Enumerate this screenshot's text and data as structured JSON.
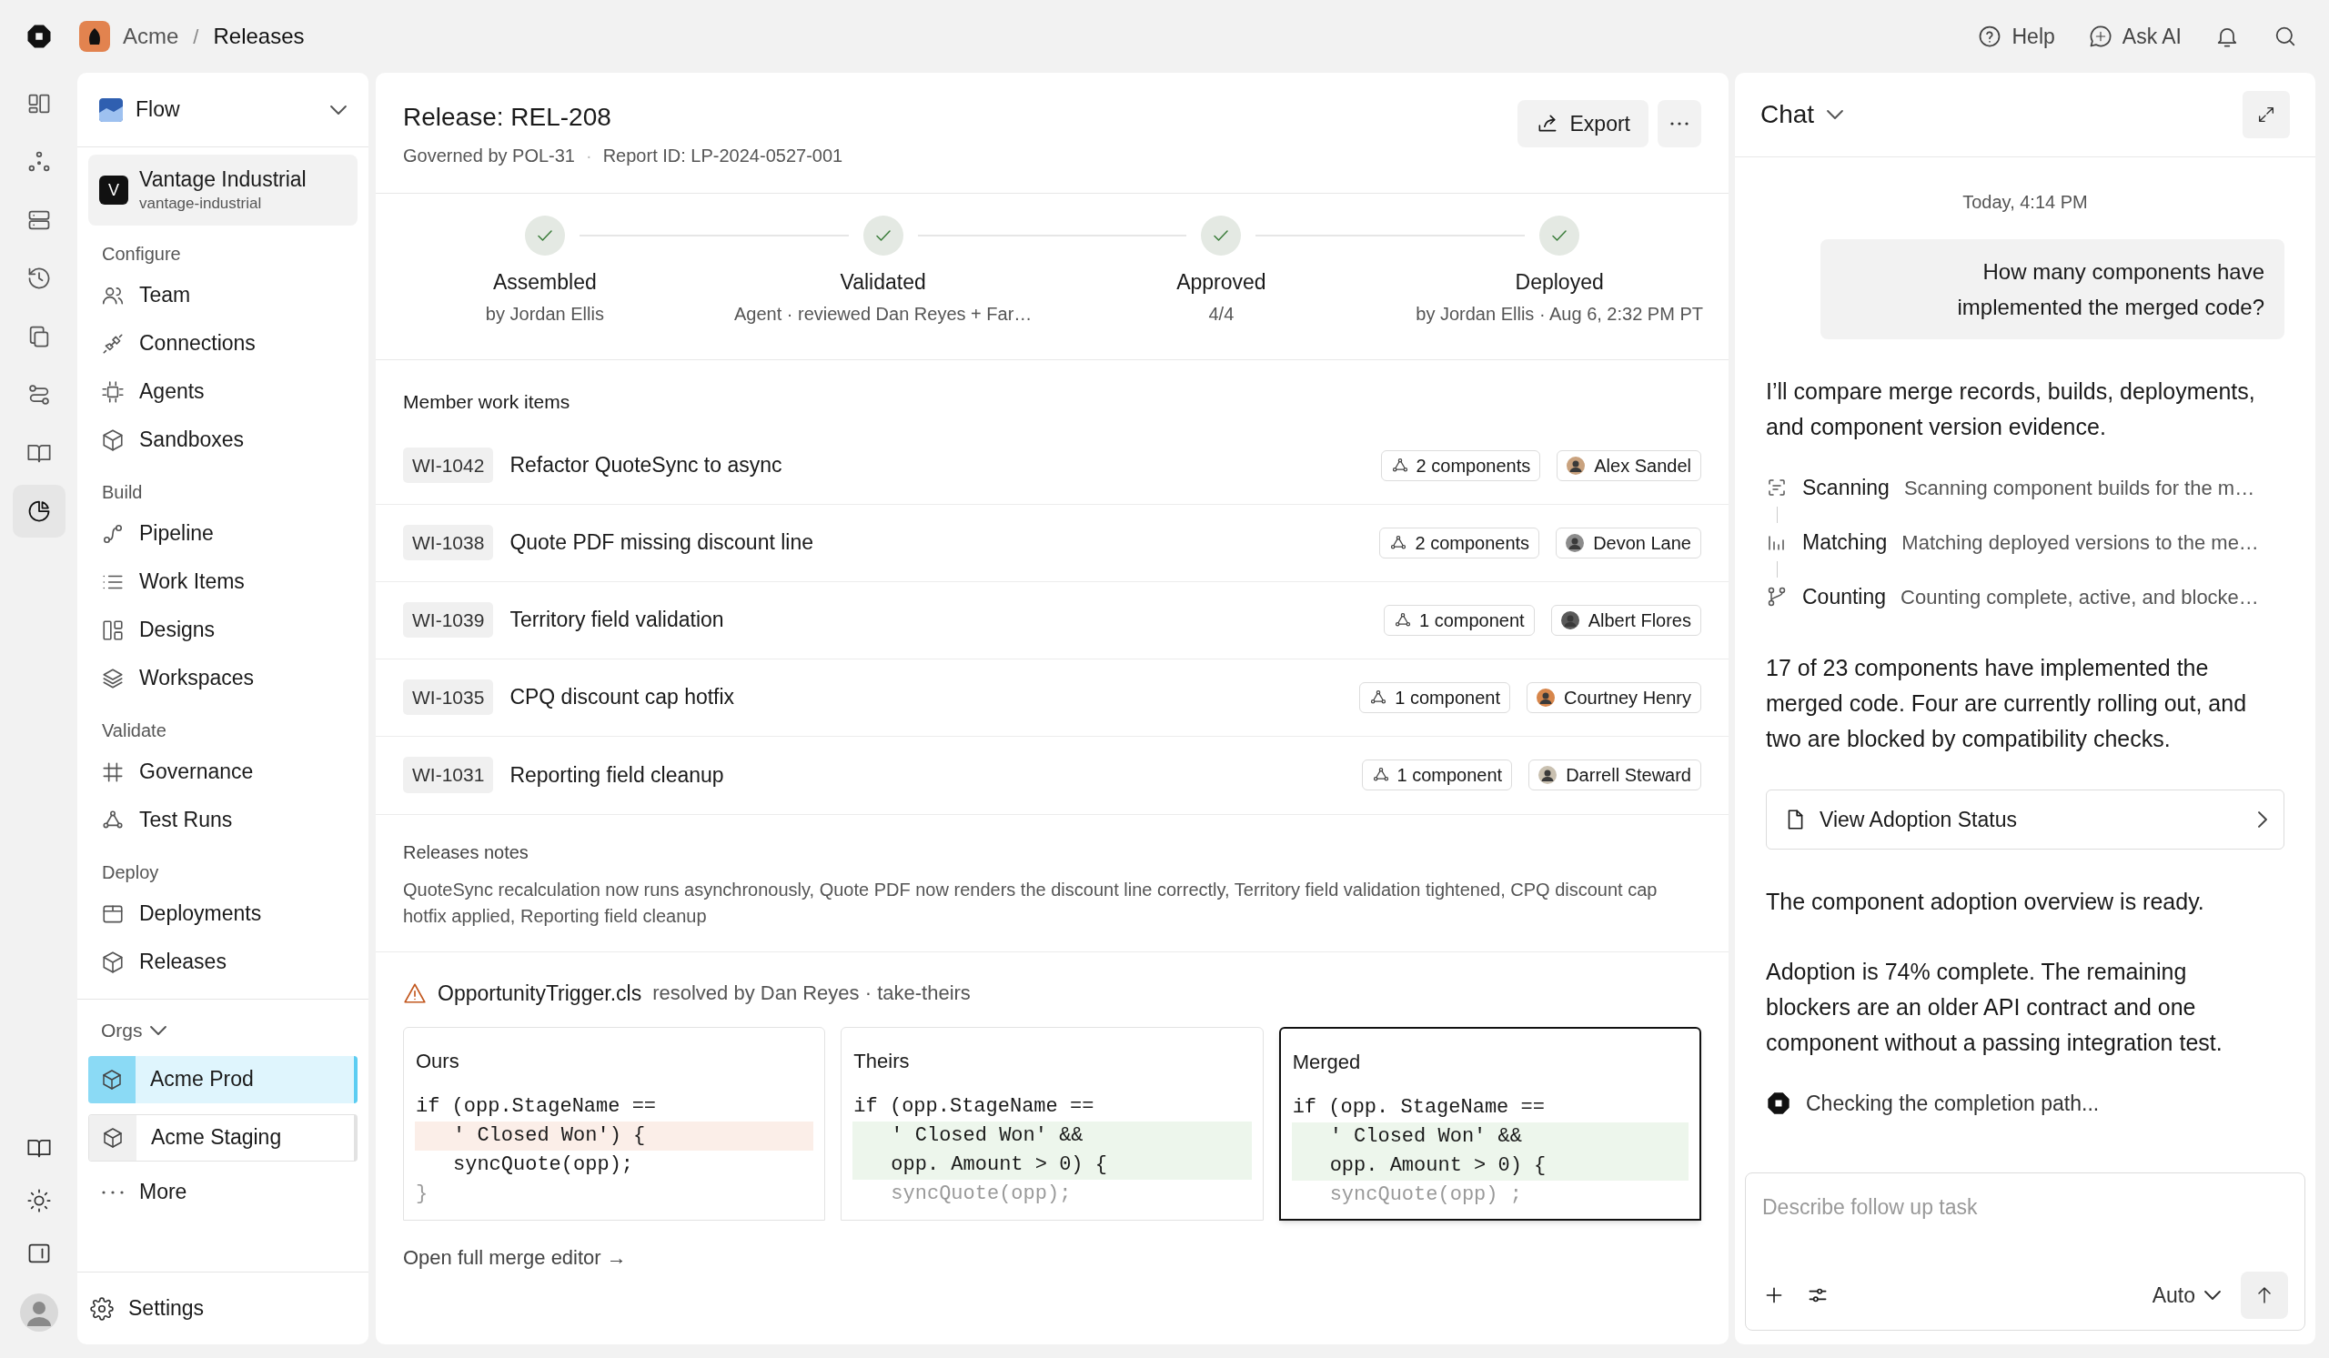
{
  "topbar": {
    "org": "Acme",
    "separator": "/",
    "page": "Releases",
    "actions": [
      {
        "label": "Help"
      },
      {
        "label": "Ask AI"
      }
    ]
  },
  "rail": {
    "items": [
      {
        "selected": false
      },
      {
        "selected": false
      },
      {
        "selected": false
      },
      {
        "selected": false
      },
      {
        "selected": false
      },
      {
        "selected": false
      },
      {
        "selected": false
      },
      {
        "selected": true
      }
    ]
  },
  "nav": {
    "workspace": "Flow",
    "account": {
      "initial": "V",
      "name": "Vantage Industrial",
      "slug": "vantage-industrial"
    },
    "sections": [
      {
        "title": "Configure",
        "items": [
          "Team",
          "Connections",
          "Agents",
          "Sandboxes"
        ]
      },
      {
        "title": "Build",
        "items": [
          "Pipeline",
          "Work Items",
          "Designs",
          "Workspaces"
        ]
      },
      {
        "title": "Validate",
        "items": [
          "Governance",
          "Test Runs"
        ]
      },
      {
        "title": "Deploy",
        "items": [
          "Deployments",
          "Releases"
        ]
      }
    ],
    "orgs": {
      "title": "Orgs",
      "items": [
        {
          "label": "Acme Prod",
          "selected": true
        },
        {
          "label": "Acme Staging",
          "selected": false
        }
      ]
    },
    "more": "More",
    "settings": "Settings"
  },
  "release": {
    "title": "Release: REL-208",
    "governed_by": "Governed by POL-31",
    "meta_separator": "·",
    "report_id": "Report ID: LP-2024-0527-001",
    "export": "Export"
  },
  "stages": [
    {
      "label": "Assembled",
      "detail": "by Jordan Ellis",
      "done": true
    },
    {
      "label": "Validated",
      "detail": "Agent · reviewed Dan Reyes + Far…",
      "done": true
    },
    {
      "label": "Approved",
      "detail": "4/4",
      "done": true
    },
    {
      "label": "Deployed",
      "detail": "by Jordan Ellis · Aug 6, 2:32 PM PT",
      "done": true
    }
  ],
  "work_items": {
    "title": "Member work items",
    "rows": [
      {
        "id": "WI-1042",
        "title": "Refactor QuoteSync to async",
        "components": "2 components",
        "assignee": "Alex Sandel"
      },
      {
        "id": "WI-1038",
        "title": "Quote PDF missing discount line",
        "components": "2 components",
        "assignee": "Devon Lane"
      },
      {
        "id": "WI-1039",
        "title": "Territory field validation",
        "components": "1 component",
        "assignee": "Albert Flores"
      },
      {
        "id": "WI-1035",
        "title": "CPQ discount cap hotfix",
        "components": "1 component",
        "assignee": "Courtney Henry"
      },
      {
        "id": "WI-1031",
        "title": "Reporting field cleanup",
        "components": "1 component",
        "assignee": "Darrell Steward"
      }
    ]
  },
  "release_notes": {
    "title": "Releases notes",
    "body": "QuoteSync recalculation now runs asynchronously, Quote PDF now renders the discount line correctly, Territory field validation tightened, CPQ discount cap hotfix applied, Reporting field cleanup"
  },
  "conflict": {
    "file": "OpportunityTrigger.cls",
    "resolution": "resolved by Dan Reyes · take-theirs",
    "panes": [
      {
        "title": "Ours",
        "selected": false,
        "lines": [
          {
            "text": "if (opp.StageName ==",
            "indented": false,
            "added": false,
            "removed": false,
            "dim": false
          },
          {
            "text": "' Closed Won') {",
            "indented": true,
            "added": false,
            "removed": true,
            "dim": false
          },
          {
            "text": "syncQuote(opp);",
            "indented": true,
            "added": false,
            "removed": false,
            "dim": false
          },
          {
            "text": "}",
            "indented": false,
            "added": false,
            "removed": false,
            "dim": true
          }
        ]
      },
      {
        "title": "Theirs",
        "selected": false,
        "lines": [
          {
            "text": "if (opp.StageName ==",
            "indented": false,
            "added": false,
            "removed": false,
            "dim": false
          },
          {
            "text": "' Closed Won' &&",
            "indented": true,
            "added": true,
            "removed": false,
            "dim": false
          },
          {
            "text": "opp. Amount > 0) {",
            "indented": true,
            "added": true,
            "removed": false,
            "dim": false
          },
          {
            "text": "syncQuote(opp);",
            "indented": true,
            "added": false,
            "removed": false,
            "dim": true
          }
        ]
      },
      {
        "title": "Merged",
        "selected": true,
        "lines": [
          {
            "text": "if (opp. StageName ==",
            "indented": false,
            "added": false,
            "removed": false,
            "dim": false
          },
          {
            "text": "' Closed Won' &&",
            "indented": true,
            "added": true,
            "removed": false,
            "dim": false
          },
          {
            "text": "opp. Amount > 0) {",
            "indented": true,
            "added": true,
            "removed": false,
            "dim": false
          },
          {
            "text": "syncQuote(opp) ;",
            "indented": true,
            "added": false,
            "removed": false,
            "dim": true
          }
        ]
      }
    ],
    "link": "Open full merge editor →"
  },
  "chat": {
    "title": "Chat",
    "timestamp": "Today, 4:14 PM",
    "user_message": "How many components have implemented the merged code?",
    "thread": [
      {
        "kind": "text",
        "text": "I’ll compare merge records, builds, deployments, and component version evidence."
      },
      {
        "kind": "steps",
        "steps": [
          {
            "label": "Scanning",
            "detail": "Scanning component builds for the m…"
          },
          {
            "label": "Matching",
            "detail": "Matching deployed versions to the me…"
          },
          {
            "label": "Counting",
            "detail": "Counting complete, active, and blocke…"
          }
        ]
      },
      {
        "kind": "text",
        "text": "17 of 23 components have implemented the merged code. Four are currently rolling out, and two are blocked by compatibility checks."
      },
      {
        "kind": "link",
        "label": "View Adoption Status"
      },
      {
        "kind": "text",
        "text": "The component adoption overview is ready."
      },
      {
        "kind": "text",
        "text": "Adoption is 74% complete. The remaining blockers are an older API contract and one component without a passing integration test."
      },
      {
        "kind": "status",
        "text": "Checking the completion path..."
      }
    ],
    "composer": {
      "placeholder": "Describe follow up task",
      "mode": "Auto"
    }
  }
}
